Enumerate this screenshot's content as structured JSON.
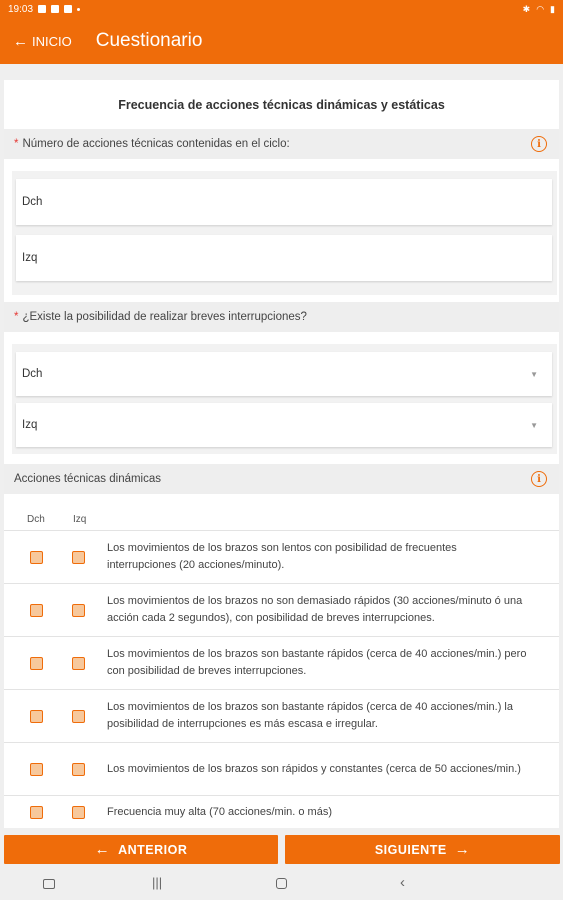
{
  "status_bar": {
    "time": "19:03"
  },
  "app_bar": {
    "back_label": "INICIO",
    "title": "Cuestionario"
  },
  "section_title": "Frecuencia de acciones técnicas dinámicas y estáticas",
  "question1": {
    "required_mark": "*",
    "label": "Número de acciones técnicas contenidas en el ciclo:",
    "fields": [
      {
        "label": "Dch"
      },
      {
        "label": "Izq"
      }
    ]
  },
  "question2": {
    "required_mark": "*",
    "label": "¿Existe la posibilidad de realizar breves interrupciones?",
    "selects": [
      {
        "value": "Dch"
      },
      {
        "value": "Izq"
      }
    ]
  },
  "dynamic_actions": {
    "label": "Acciones técnicas dinámicas",
    "col_right": "Dch",
    "col_left": "Izq",
    "options": [
      {
        "text": "Los movimientos de los brazos son lentos con posibilidad de frecuentes interrupciones (20 acciones/minuto)."
      },
      {
        "text": "Los movimientos de los brazos no son demasiado rápidos (30 acciones/minuto ó una acción cada 2 segundos), con posibilidad de breves interrupciones."
      },
      {
        "text": "Los movimientos de los brazos son bastante rápidos (cerca de 40 acciones/min.) pero con posibilidad de breves interrupciones."
      },
      {
        "text": "Los movimientos de los brazos son bastante rápidos (cerca de 40 acciones/min.) la posibilidad de interrupciones es más escasa e irregular."
      },
      {
        "text": "Los movimientos de los brazos son rápidos y constantes (cerca de 50 acciones/min.)"
      },
      {
        "text": "Frecuencia muy alta (70 acciones/min. o más)"
      }
    ]
  },
  "buttons": {
    "prev": "ANTERIOR",
    "next": "SIGUIENTE"
  },
  "colors": {
    "accent": "#ef6c0a",
    "required": "#e53935"
  }
}
